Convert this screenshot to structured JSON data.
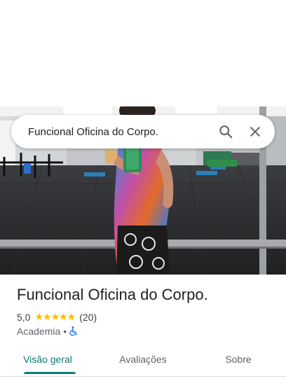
{
  "search": {
    "query": "Funcional Oficina do Corpo."
  },
  "place": {
    "title": "Funcional Oficina do Corpo.",
    "rating": "5,0",
    "stars": "★★★★★",
    "reviews": "(20)",
    "category": "Academia",
    "separator": "•",
    "icons": [
      "search-icon",
      "close-icon",
      "wheelchair-accessible-icon"
    ]
  },
  "tabs": [
    {
      "label": "Visão geral",
      "active": true
    },
    {
      "label": "Avaliações",
      "active": false
    },
    {
      "label": "Sobre",
      "active": false
    }
  ],
  "colors": {
    "accent": "#0b7a75",
    "star": "#fbbc04",
    "access_icon": "#1a73e8"
  }
}
